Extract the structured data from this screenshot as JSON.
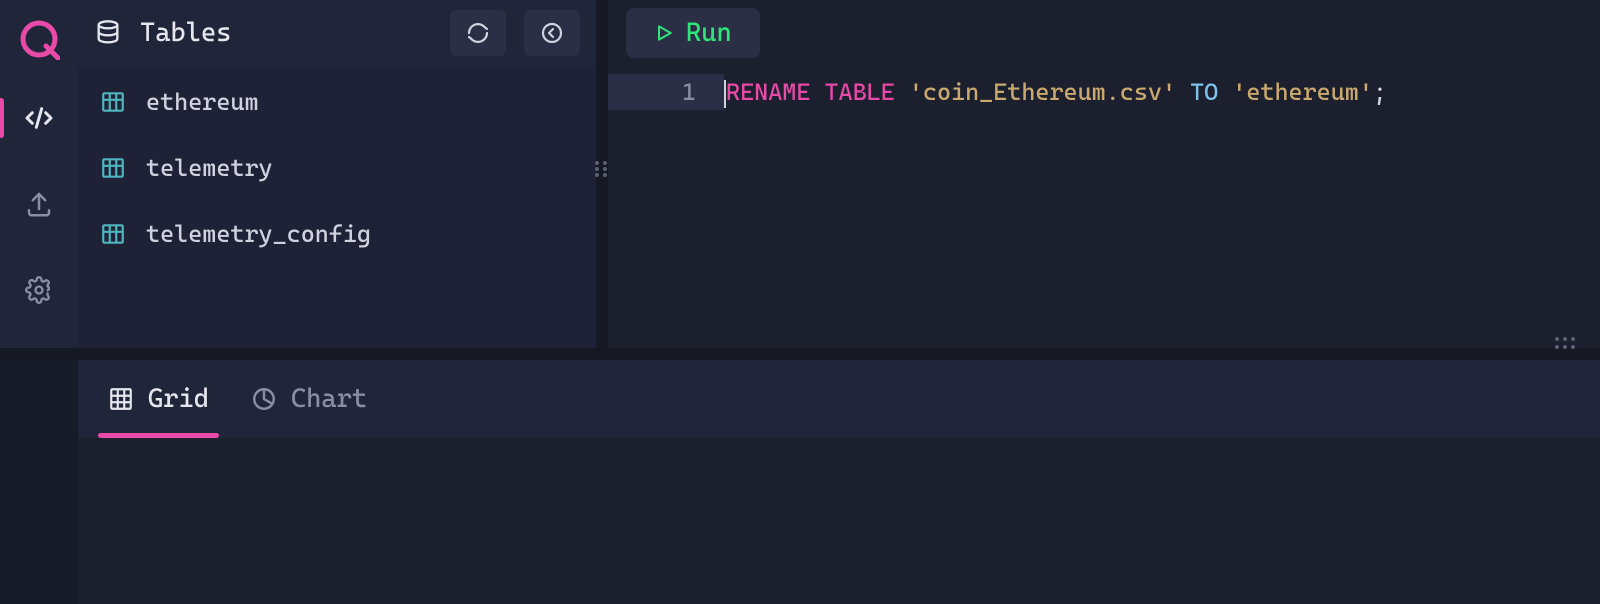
{
  "sidebar": {
    "tables_label": "Tables",
    "items": [
      {
        "name": "ethereum"
      },
      {
        "name": "telemetry"
      },
      {
        "name": "telemetry_config"
      }
    ]
  },
  "editor": {
    "run_label": "Run",
    "line_numbers": [
      "1"
    ],
    "code": {
      "kw_rename": "RENAME",
      "kw_table": "TABLE",
      "str_from": "'coin_Ethereum.csv'",
      "kw_to": "TO",
      "str_to": "'ethereum'",
      "tail": ";"
    }
  },
  "results": {
    "tabs": [
      {
        "id": "grid",
        "label": "Grid"
      },
      {
        "id": "chart",
        "label": "Chart"
      }
    ],
    "active_tab": "grid"
  }
}
